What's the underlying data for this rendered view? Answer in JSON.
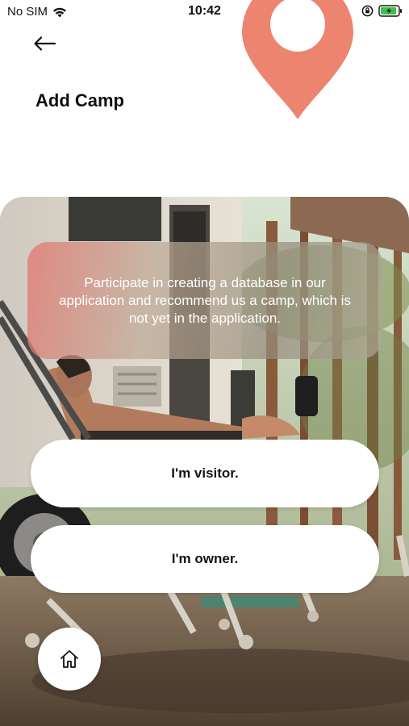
{
  "status_bar": {
    "carrier": "No SIM",
    "time": "10:42"
  },
  "header": {
    "title": "Add Camp",
    "back_icon": "arrow-left-icon",
    "pin_icon": "location-pin-icon",
    "pin_color": "#EC8470"
  },
  "hero": {
    "message": "Participate in creating a database in our application and recommend us a camp, which is not yet in the application.",
    "visitor_label": "I'm visitor.",
    "owner_label": "I'm owner."
  },
  "bottom_nav": {
    "home_icon": "home-icon"
  }
}
